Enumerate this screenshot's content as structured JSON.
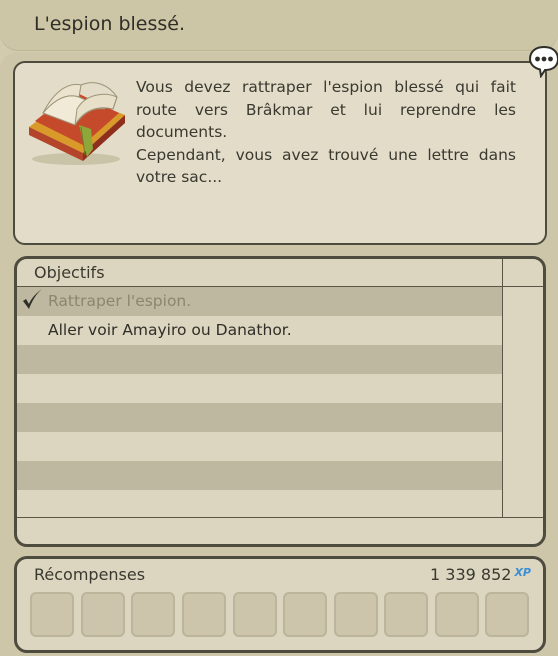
{
  "quest": {
    "title": "L'espion blessé.",
    "description_lines": [
      "Vous devez rattraper l'espion blessé qui fait route vers Brâkmar et lui reprendre les documents.",
      "Cependant, vous avez trouvé une lettre dans votre sac..."
    ]
  },
  "icons": {
    "quest": "quest-book-icon",
    "chat": "speech-bubble-icon",
    "check": "checkmark-icon"
  },
  "objectives": {
    "header": "Objectifs",
    "items": [
      {
        "label": "Rattraper l'espion.",
        "done": true
      },
      {
        "label": "Aller voir Amayiro ou Danathor.",
        "done": false
      }
    ]
  },
  "rewards": {
    "header": "Récompenses",
    "xp_value": "1 339 852",
    "xp_unit": "XP",
    "slot_count": 10
  },
  "colors": {
    "xp_badge": "#3a8fd6",
    "row_dark": "#bfb8a0",
    "row_light": "#dcd6c0"
  }
}
